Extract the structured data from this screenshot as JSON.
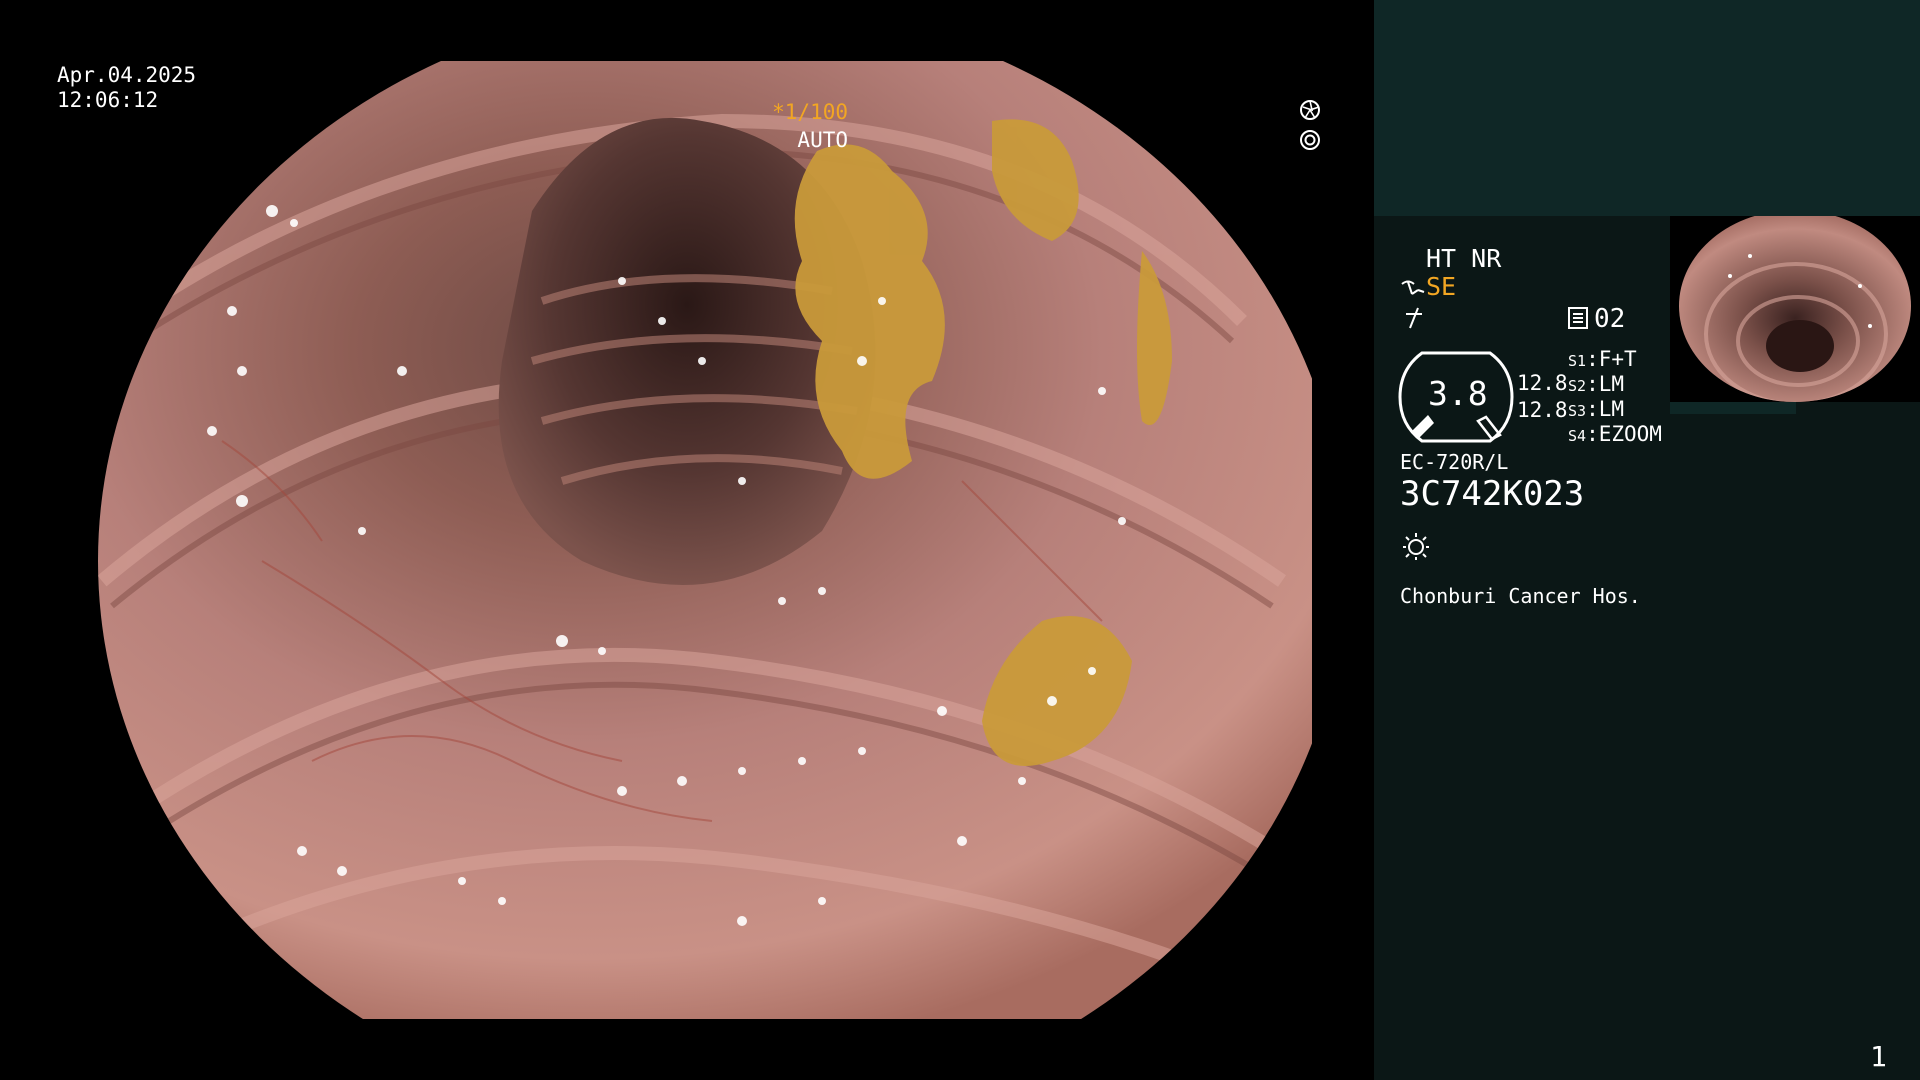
{
  "overlay": {
    "date": "Apr.04.2025",
    "time": "12:06:12",
    "shutter": "*1/100",
    "iris_mode": "AUTO"
  },
  "panel": {
    "color_mode": "HT NR",
    "structure_enhancement": "SE",
    "memory_number": "02",
    "gauge_value": "3.8",
    "value_1": "12.8",
    "value_2": "12.8",
    "switches": [
      {
        "key": "S1",
        "value": "F+T"
      },
      {
        "key": "S2",
        "value": "LM"
      },
      {
        "key": "S3",
        "value": "LM"
      },
      {
        "key": "S4",
        "value": "EZOOM"
      }
    ],
    "scope_model": "EC-720R/L",
    "scope_serial": "3C742K023",
    "hospital": "Chonburi Cancer Hos.",
    "page_number": "1"
  },
  "colors": {
    "accent_orange": "#f2a623",
    "panel_background": "#0b1716",
    "panel_top_background": "#0f2726",
    "mucosa_base": "#b0756a",
    "stool_residue": "#c99a3a"
  },
  "icons": {
    "shutter": "shutter-icon",
    "iris": "iris-icon",
    "structure_enhancement": "se-icon",
    "enhancement": "enhancement-icon",
    "memory": "memory-icon",
    "light": "light-icon"
  }
}
